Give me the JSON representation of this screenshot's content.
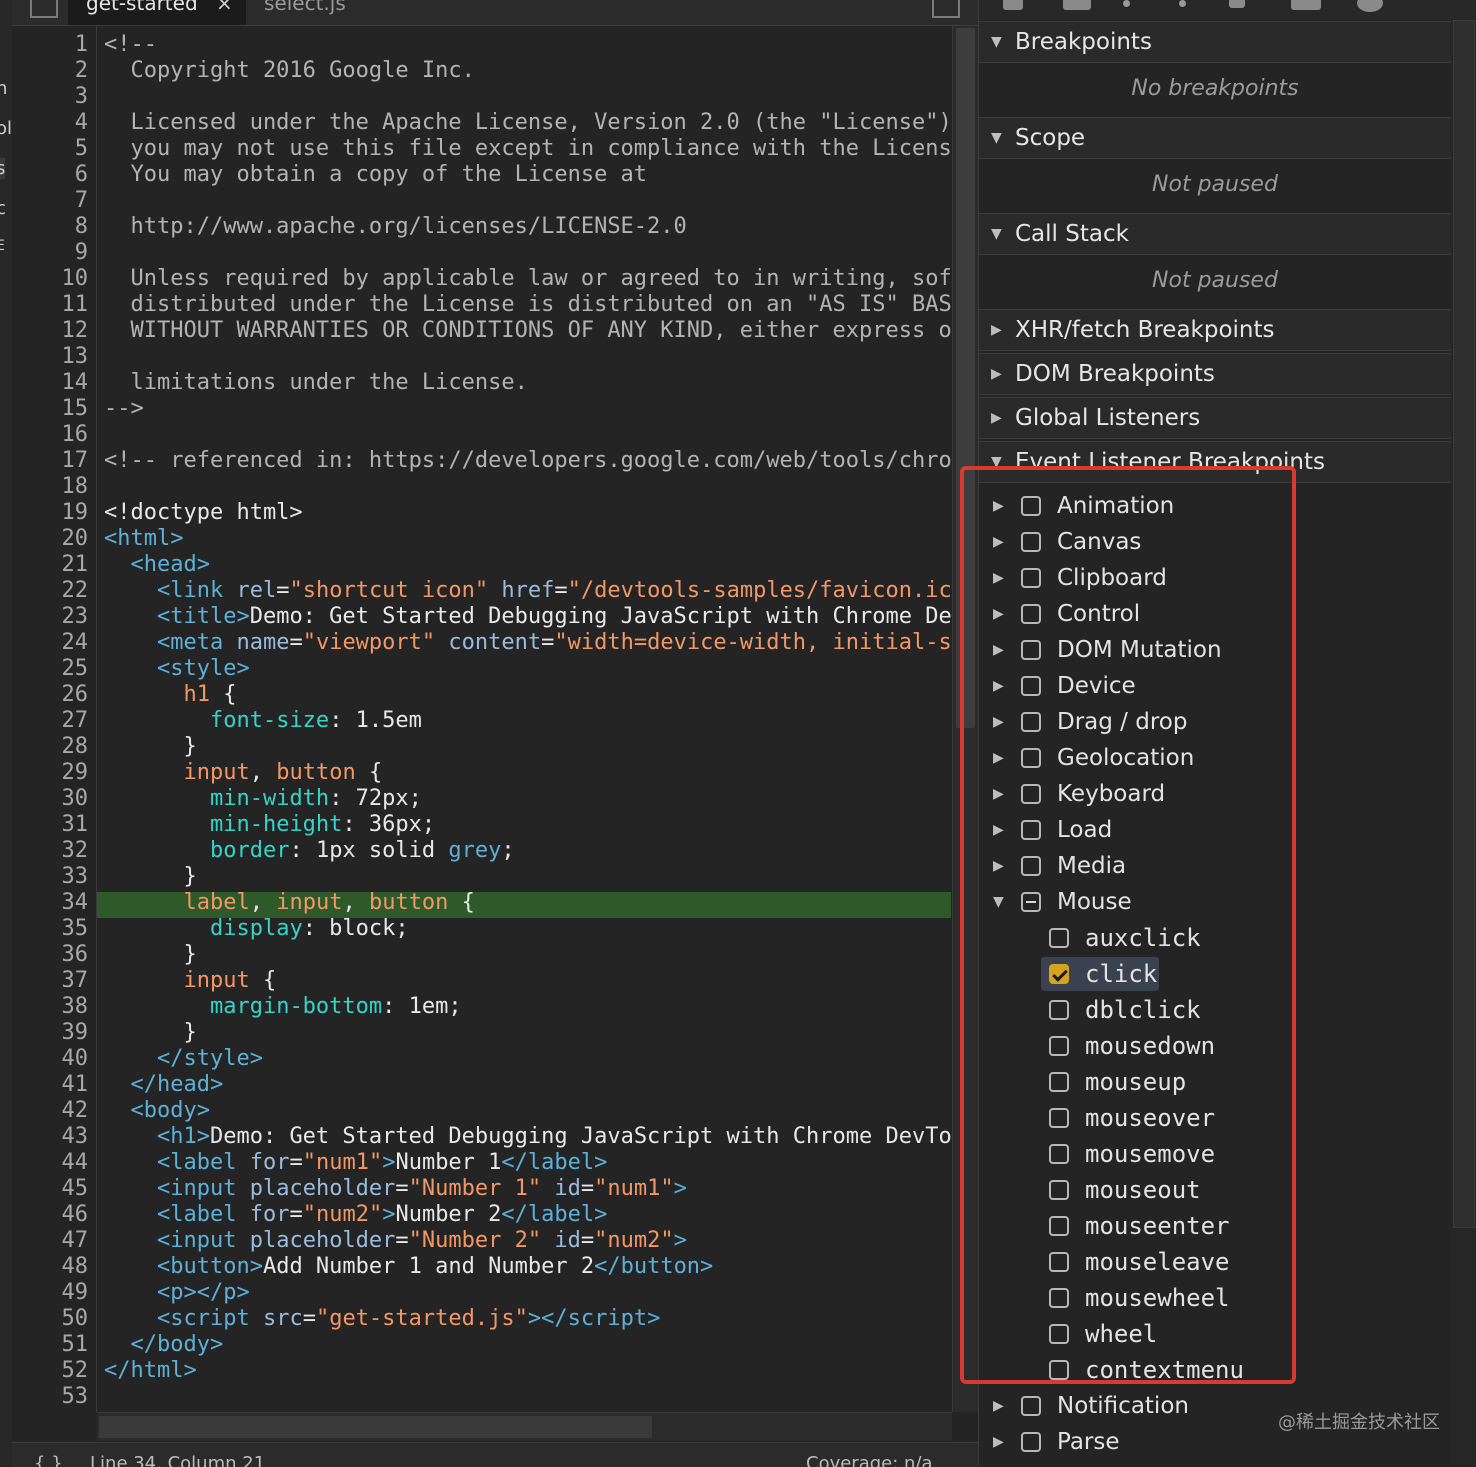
{
  "editor": {
    "tabs": [
      {
        "label": "get-started",
        "close": "×"
      },
      {
        "label": "select.js"
      }
    ],
    "line_numbers": [
      "1",
      "2",
      "3",
      "4",
      "5",
      "6",
      "7",
      "8",
      "9",
      "10",
      "11",
      "12",
      "13",
      "14",
      "15",
      "16",
      "17",
      "18",
      "19",
      "20",
      "21",
      "22",
      "23",
      "24",
      "25",
      "26",
      "27",
      "28",
      "29",
      "30",
      "31",
      "32",
      "33",
      "34",
      "35",
      "36",
      "37",
      "38",
      "39",
      "40",
      "41",
      "42",
      "43",
      "44",
      "45",
      "46",
      "47",
      "48",
      "49",
      "50",
      "51",
      "52",
      "53"
    ],
    "highlighted_line": "34",
    "status": {
      "braces": "{ }",
      "position": "Line 34, Column 21",
      "coverage": "Coverage: n/a"
    }
  },
  "left_strip_fragments": [
    "n",
    "ol",
    "s",
    "c",
    "E"
  ],
  "debugger": {
    "sections": [
      {
        "title": "Breakpoints",
        "expanded": true,
        "message": "No breakpoints"
      },
      {
        "title": "Scope",
        "expanded": true,
        "message": "Not paused"
      },
      {
        "title": "Call Stack",
        "expanded": true,
        "message": "Not paused"
      },
      {
        "title": "XHR/fetch Breakpoints",
        "expanded": false
      },
      {
        "title": "DOM Breakpoints",
        "expanded": false
      },
      {
        "title": "Global Listeners",
        "expanded": false
      },
      {
        "title": "Event Listener Breakpoints",
        "expanded": true
      }
    ],
    "event_categories": [
      {
        "label": "Animation",
        "state": "unchecked"
      },
      {
        "label": "Canvas",
        "state": "unchecked"
      },
      {
        "label": "Clipboard",
        "state": "unchecked"
      },
      {
        "label": "Control",
        "state": "unchecked"
      },
      {
        "label": "DOM Mutation",
        "state": "unchecked"
      },
      {
        "label": "Device",
        "state": "unchecked"
      },
      {
        "label": "Drag / drop",
        "state": "unchecked"
      },
      {
        "label": "Geolocation",
        "state": "unchecked"
      },
      {
        "label": "Keyboard",
        "state": "unchecked"
      },
      {
        "label": "Load",
        "state": "unchecked"
      },
      {
        "label": "Media",
        "state": "unchecked"
      },
      {
        "label": "Mouse",
        "state": "indeterminate",
        "expanded": true
      }
    ],
    "mouse_events": [
      {
        "label": "auxclick",
        "checked": false
      },
      {
        "label": "click",
        "checked": true
      },
      {
        "label": "dblclick",
        "checked": false
      },
      {
        "label": "mousedown",
        "checked": false
      },
      {
        "label": "mouseup",
        "checked": false
      },
      {
        "label": "mouseover",
        "checked": false
      },
      {
        "label": "mousemove",
        "checked": false
      },
      {
        "label": "mouseout",
        "checked": false
      },
      {
        "label": "mouseenter",
        "checked": false
      },
      {
        "label": "mouseleave",
        "checked": false
      },
      {
        "label": "mousewheel",
        "checked": false
      },
      {
        "label": "wheel",
        "checked": false
      },
      {
        "label": "contextmenu",
        "checked": false
      }
    ],
    "more_categories": [
      {
        "label": "Notification",
        "state": "unchecked"
      },
      {
        "label": "Parse",
        "state": "unchecked"
      }
    ]
  },
  "watermark": "@稀土掘金技术社区",
  "colors": {
    "highlight_line": "#2e5a2a",
    "annotation_box": "#d93a2f",
    "checkbox_checked": "#d6a31f"
  }
}
